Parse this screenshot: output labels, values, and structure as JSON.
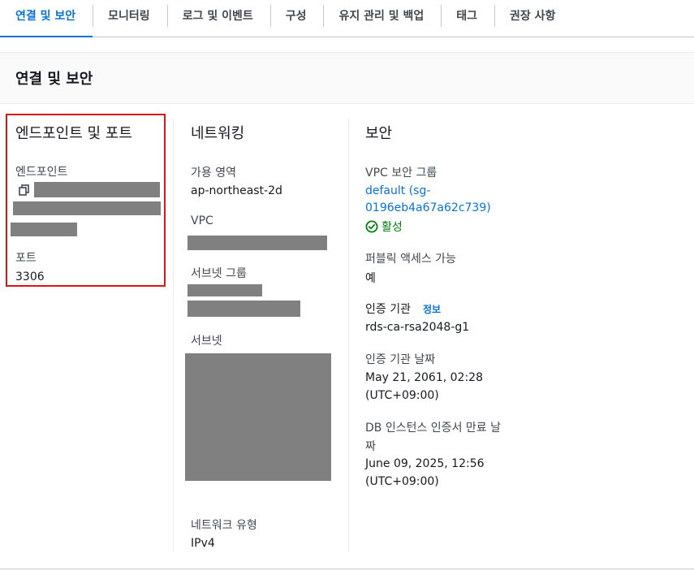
{
  "tabs": [
    {
      "label": "연결 및 보안",
      "active": true
    },
    {
      "label": "모니터링"
    },
    {
      "label": "로그 및 이벤트"
    },
    {
      "label": "구성"
    },
    {
      "label": "유지 관리 및 백업"
    },
    {
      "label": "태그"
    },
    {
      "label": "권장 사항"
    }
  ],
  "section": {
    "title": "연결 및 보안"
  },
  "endpoint_col": {
    "title": "엔드포인트 및 포트",
    "endpoint_label": "엔드포인트",
    "port_label": "포트",
    "port_value": "3306"
  },
  "network_col": {
    "title": "네트워킹",
    "az_label": "가용 영역",
    "az_value": "ap-northeast-2d",
    "vpc_label": "VPC",
    "subnet_group_label": "서브넷 그룹",
    "subnets_label": "서브넷",
    "network_type_label": "네트워크 유형",
    "network_type_value": "IPv4"
  },
  "security_col": {
    "title": "보안",
    "sg_label": "VPC 보안 그룹",
    "sg_link_line1": "default (sg-",
    "sg_link_line2": "0196eb4a67a62c739)",
    "sg_status": "활성",
    "public_label": "퍼블릭 액세스 가능",
    "public_value": "예",
    "ca_label": "인증 기관",
    "ca_info": "정보",
    "ca_value": "rds-ca-rsa2048-g1",
    "ca_date_label": "인증 기관 날짜",
    "ca_date_line1": "May 21, 2061, 02:28",
    "ca_date_line2": "(UTC+09:00)",
    "cert_exp_label_line1": "DB 인스턴스 인증서 만료 날",
    "cert_exp_label_line2": "짜",
    "cert_exp_line1": "June 09, 2025, 12:56",
    "cert_exp_line2": "(UTC+09:00)"
  },
  "colors": {
    "accent": "#0972d3",
    "success": "#037f0c",
    "highlight": "#d91515",
    "redaction": "#808080"
  },
  "icons": {
    "copy": "copy-icon",
    "status": "check-circle-icon"
  }
}
